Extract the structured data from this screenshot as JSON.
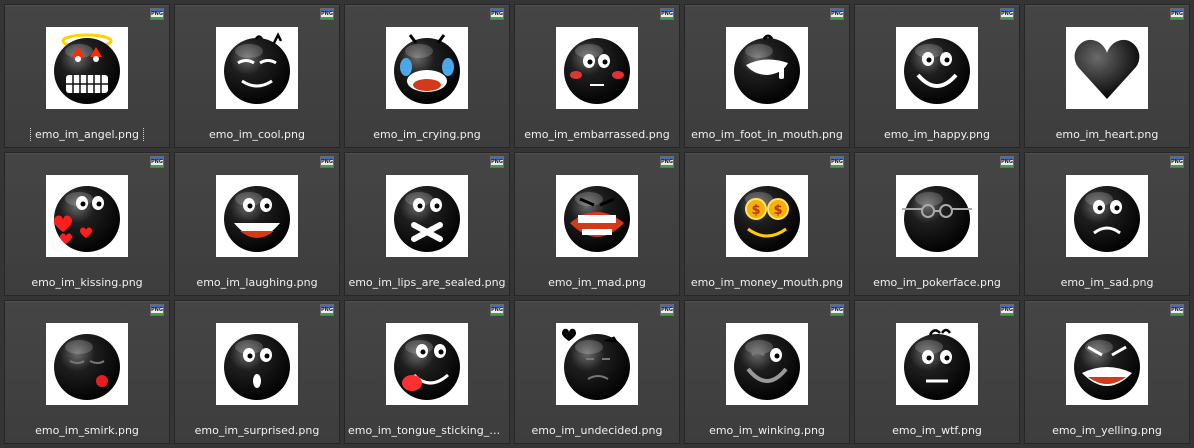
{
  "badge_text": "PNG",
  "files": [
    {
      "name": "emo_im_angel.png",
      "icon": "angel",
      "selected": true
    },
    {
      "name": "emo_im_cool.png",
      "icon": "cool"
    },
    {
      "name": "emo_im_crying.png",
      "icon": "crying"
    },
    {
      "name": "emo_im_embarrassed.png",
      "icon": "embarrassed"
    },
    {
      "name": "emo_im_foot_in_mouth.png",
      "icon": "foot_in_mouth"
    },
    {
      "name": "emo_im_happy.png",
      "icon": "happy"
    },
    {
      "name": "emo_im_heart.png",
      "icon": "heart"
    },
    {
      "name": "emo_im_kissing.png",
      "icon": "kissing"
    },
    {
      "name": "emo_im_laughing.png",
      "icon": "laughing"
    },
    {
      "name": "emo_im_lips_are_sealed.png",
      "icon": "lips_sealed"
    },
    {
      "name": "emo_im_mad.png",
      "icon": "mad"
    },
    {
      "name": "emo_im_money_mouth.png",
      "icon": "money_mouth"
    },
    {
      "name": "emo_im_pokerface.png",
      "icon": "pokerface"
    },
    {
      "name": "emo_im_sad.png",
      "icon": "sad"
    },
    {
      "name": "emo_im_smirk.png",
      "icon": "smirk"
    },
    {
      "name": "emo_im_surprised.png",
      "icon": "surprised"
    },
    {
      "name": "emo_im_tongue_sticking_ou...",
      "icon": "tongue"
    },
    {
      "name": "emo_im_undecided.png",
      "icon": "undecided"
    },
    {
      "name": "emo_im_winking.png",
      "icon": "winking"
    },
    {
      "name": "emo_im_wtf.png",
      "icon": "wtf"
    },
    {
      "name": "emo_im_yelling.png",
      "icon": "yelling"
    }
  ]
}
